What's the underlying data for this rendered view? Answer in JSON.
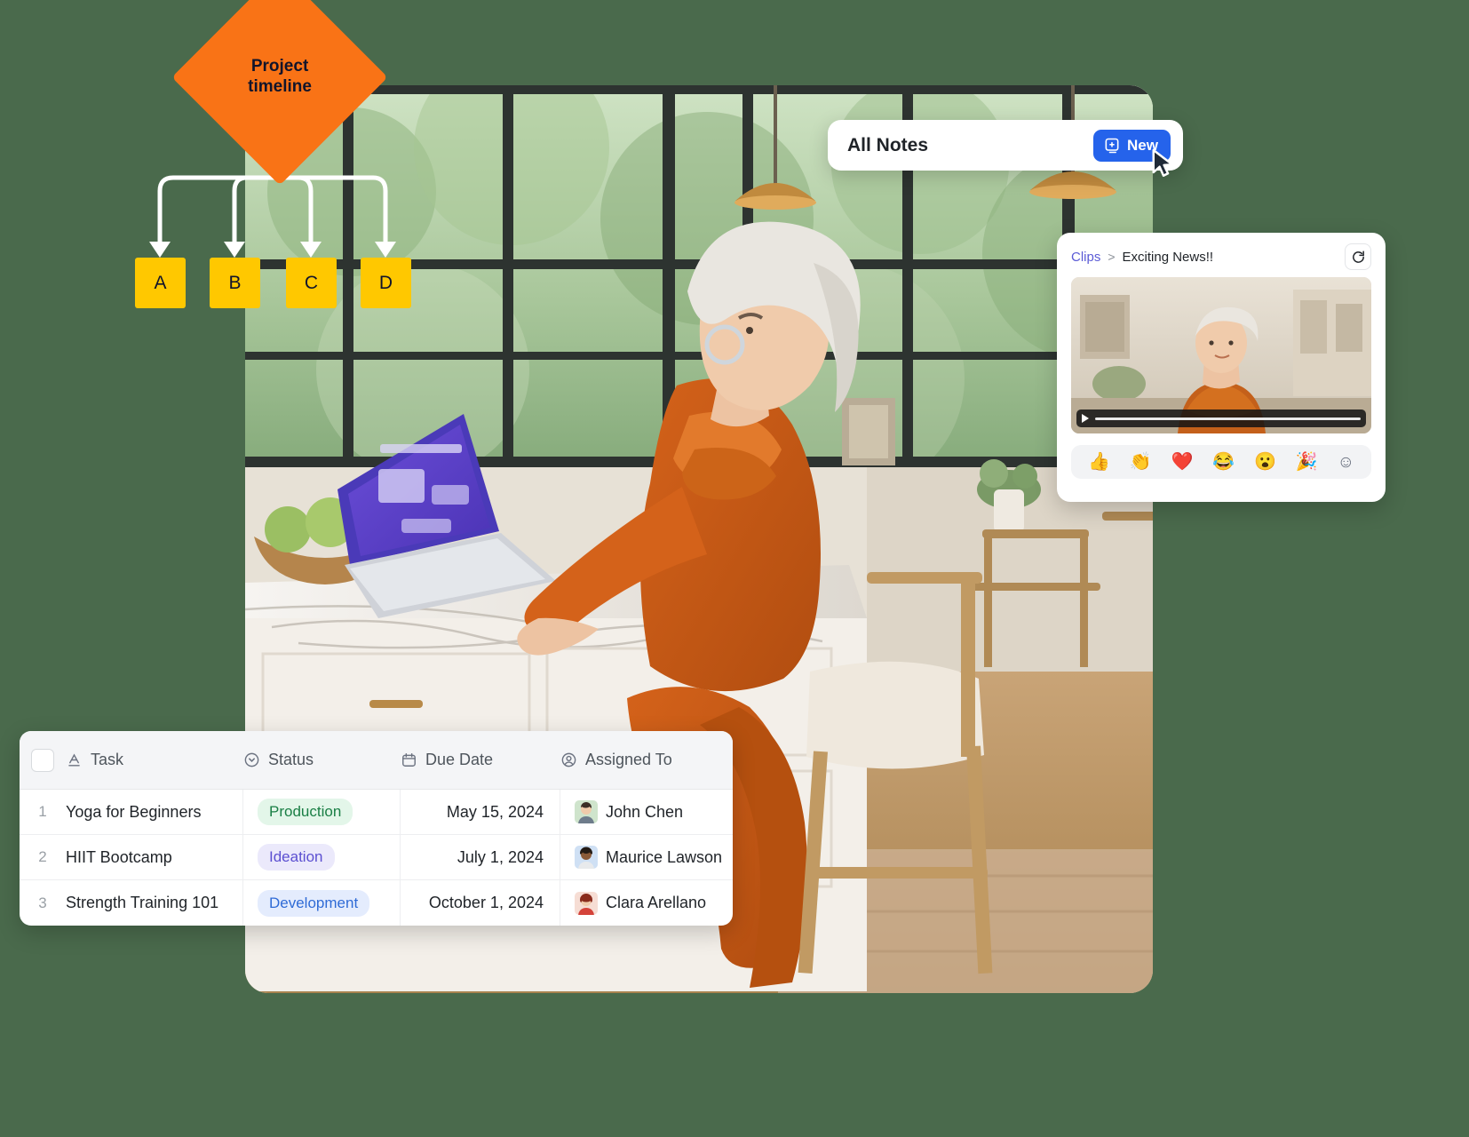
{
  "page": {
    "background_color": "#4a6a4c"
  },
  "flowchart": {
    "root": {
      "label": "Project\ntimeline",
      "color": "#F97316",
      "shape": "diamond"
    },
    "node_color": "#FFC800",
    "nodes": [
      {
        "label": "A"
      },
      {
        "label": "B"
      },
      {
        "label": "C"
      },
      {
        "label": "D"
      }
    ]
  },
  "notes_card": {
    "title": "All Notes",
    "new_label": "New",
    "new_button_color": "#2563EB",
    "new_icon": "new-note-icon",
    "cursor_icon": "mouse-pointer-icon"
  },
  "clips_card": {
    "breadcrumb_root": "Clips",
    "breadcrumb_separator": ">",
    "breadcrumb_current": "Exciting News!!",
    "breadcrumb_link_color": "#5b5bd6",
    "refresh_icon": "refresh-icon",
    "video": {
      "play_icon": "play-icon",
      "progress_percent": 0
    },
    "reactions": [
      {
        "name": "thumbs-up-reaction",
        "glyph": "👍"
      },
      {
        "name": "clap-reaction",
        "glyph": "👏"
      },
      {
        "name": "heart-reaction",
        "glyph": "❤️"
      },
      {
        "name": "laughing-reaction",
        "glyph": "😂"
      },
      {
        "name": "surprised-reaction",
        "glyph": "😮"
      },
      {
        "name": "party-popper-reaction",
        "glyph": "🎉"
      },
      {
        "name": "add-reaction",
        "glyph": "☺"
      }
    ]
  },
  "task_table": {
    "columns": [
      {
        "label": "Task",
        "icon": "text-format-icon"
      },
      {
        "label": "Status",
        "icon": "status-circle-icon"
      },
      {
        "label": "Due Date",
        "icon": "calendar-icon"
      },
      {
        "label": "Assigned To",
        "icon": "person-circle-icon"
      }
    ],
    "rows": [
      {
        "num": "1",
        "task": "Yoga for Beginners",
        "status": "Production",
        "status_class": "production",
        "due_date": "May 15, 2024",
        "assignee": "John Chen"
      },
      {
        "num": "2",
        "task": "HIIT Bootcamp",
        "status": "Ideation",
        "status_class": "ideation",
        "due_date": "July 1, 2024",
        "assignee": "Maurice Lawson"
      },
      {
        "num": "3",
        "task": "Strength Training 101",
        "status": "Development",
        "status_class": "development",
        "due_date": "October 1, 2024",
        "assignee": "Clara Arellano"
      }
    ]
  }
}
